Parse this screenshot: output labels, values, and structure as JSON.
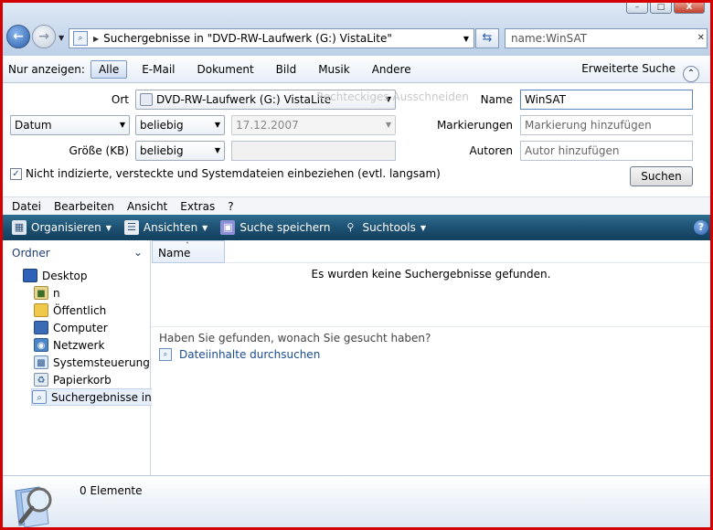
{
  "window": {
    "address": "Suchergebnisse in \"DVD-RW-Laufwerk (G:) VistaLite\"",
    "search_value": "name:WinSAT",
    "min": "–",
    "max": "□",
    "close": "X"
  },
  "filterbar": {
    "label": "Nur anzeigen:",
    "tabs": [
      "Alle",
      "E-Mail",
      "Dokument",
      "Bild",
      "Musik",
      "Andere"
    ],
    "active_tab": "Alle",
    "advanced": "Erweiterte Suche"
  },
  "advanced": {
    "ort_label": "Ort",
    "ort_value": "DVD-RW-Laufwerk (G:) VistaLite",
    "ghost_text": "Rechteckiges Ausschneiden",
    "date_field": "Datum",
    "date_op": "beliebig",
    "date_value": "17.12.2007",
    "size_label": "Größe (KB)",
    "size_op": "beliebig",
    "size_value": "",
    "name_label": "Name",
    "name_value": "WinSAT",
    "tags_label": "Markierungen",
    "tags_placeholder": "Markierung hinzufügen",
    "authors_label": "Autoren",
    "authors_placeholder": "Autor hinzufügen",
    "include_hidden": "Nicht indizierte, versteckte und Systemdateien einbeziehen (evtl. langsam)",
    "include_checked": true,
    "search_button": "Suchen"
  },
  "menubar": [
    "Datei",
    "Bearbeiten",
    "Ansicht",
    "Extras",
    "?"
  ],
  "commandbar": {
    "organize": "Organisieren",
    "views": "Ansichten",
    "save_search": "Suche speichern",
    "search_tools": "Suchtools",
    "help": "?"
  },
  "navpane": {
    "header": "Ordner",
    "items": [
      "Desktop",
      "n",
      "Öffentlich",
      "Computer",
      "Netzwerk",
      "Systemsteuerung",
      "Papierkorb",
      "Suchergebnisse in \""
    ]
  },
  "content": {
    "column_name": "Name",
    "no_results": "Es wurden keine Suchergebnisse gefunden.",
    "hint": "Haben Sie gefunden, wonach Sie gesucht haben?",
    "link": "Dateiinhalte durchsuchen"
  },
  "details": {
    "count": "0 Elemente"
  },
  "colors": {
    "frame": "#d40000",
    "commandbar": "#1c4f70",
    "link": "#1b4d8f"
  }
}
